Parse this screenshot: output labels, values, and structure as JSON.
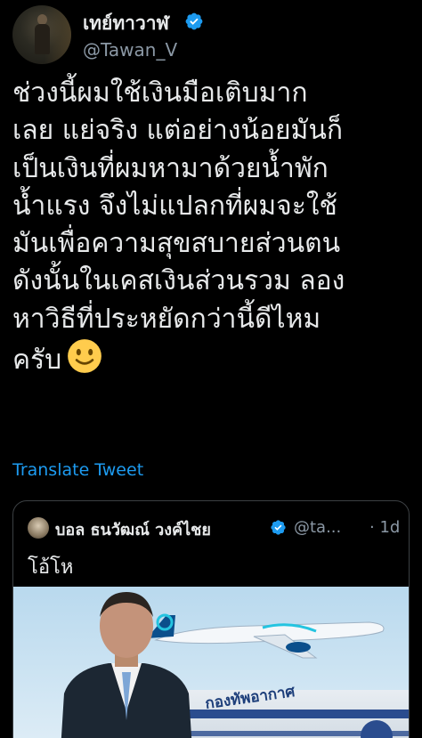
{
  "tweet": {
    "author": {
      "display_name": "เทย์ทาวาฬ",
      "handle": "@Tawan_V",
      "verified": true
    },
    "text_lines": [
      "ช่วงนี้ผมใช้เงินมือเติบมาก",
      "เลย แย่จริง แต่อย่างน้อยมันก็",
      "เป็นเงินที่ผมหามาด้วยน้ำพัก",
      "น้ำแรง จึงไม่แปลกที่ผมจะใช้",
      "มันเพื่อความสุขสบายส่วนตน",
      "ดังนั้นในเคสเงินส่วนรวม ลอง",
      "หาวิธีที่ประหยัดกว่านี้ดีไหม",
      "ครับ"
    ],
    "emoji": "slightly-smiling-face",
    "translate_label": "Translate Tweet"
  },
  "quoted": {
    "display_name": "บอล ธนวัฒณ์ วงค์ไชย",
    "handle": "@ta...",
    "separator": "·",
    "time": "1d",
    "verified": true,
    "text": "โอ้โห",
    "media": {
      "building_text": "กองทัพอากาศ"
    }
  },
  "colors": {
    "background": "#000000",
    "text": "#e7e9ea",
    "secondary": "#8b98a5",
    "link": "#1d9bf0",
    "verified": "#1d9bf0",
    "border": "#3c4043"
  }
}
